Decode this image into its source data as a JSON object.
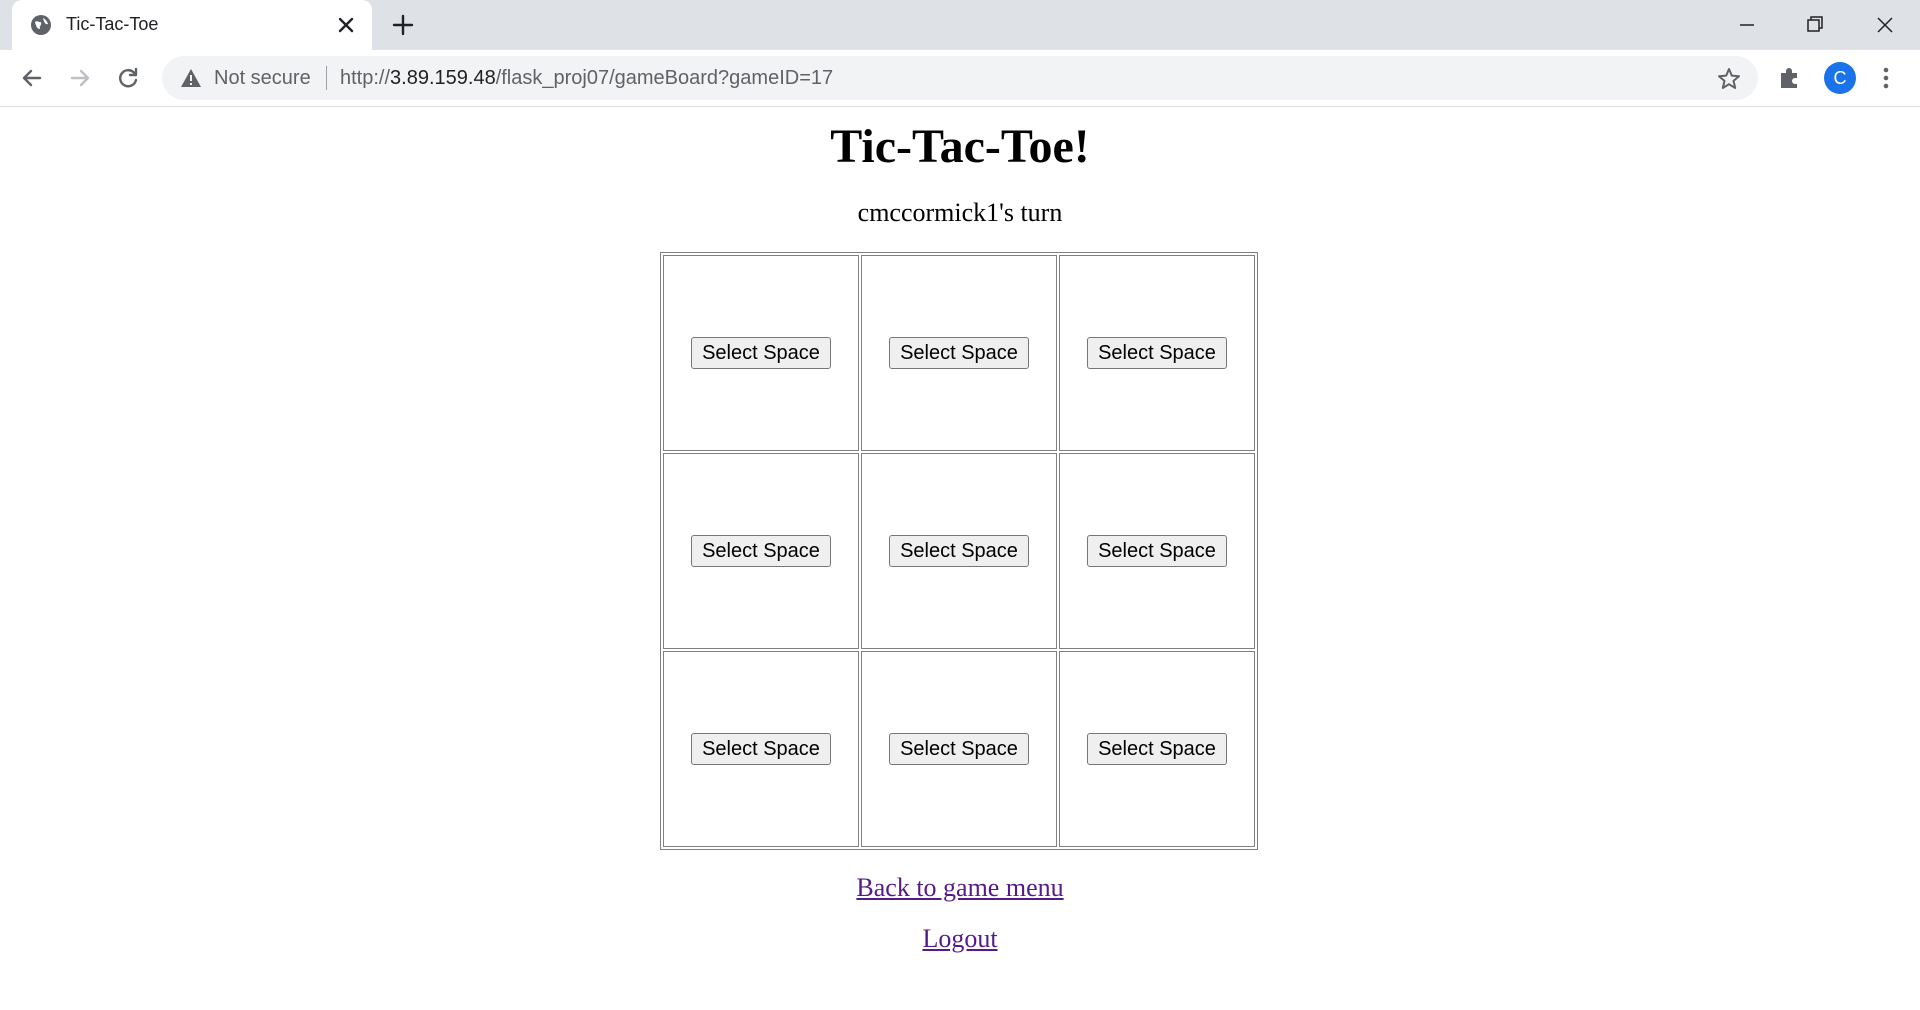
{
  "browser": {
    "tab_title": "Tic-Tac-Toe",
    "security_label": "Not secure",
    "url_scheme": "http://",
    "url_host": "3.89.159.48",
    "url_path": "/flask_proj07/gameBoard?gameID=17",
    "profile_initial": "C",
    "profile_color": "#1a73e8"
  },
  "page": {
    "title": "Tic-Tac-Toe!",
    "turn_text": "cmccormick1's turn",
    "board": [
      [
        "Select Space",
        "Select Space",
        "Select Space"
      ],
      [
        "Select Space",
        "Select Space",
        "Select Space"
      ],
      [
        "Select Space",
        "Select Space",
        "Select Space"
      ]
    ],
    "back_link": "Back to game menu",
    "logout_link": "Logout",
    "link_color": "#551a8b"
  }
}
